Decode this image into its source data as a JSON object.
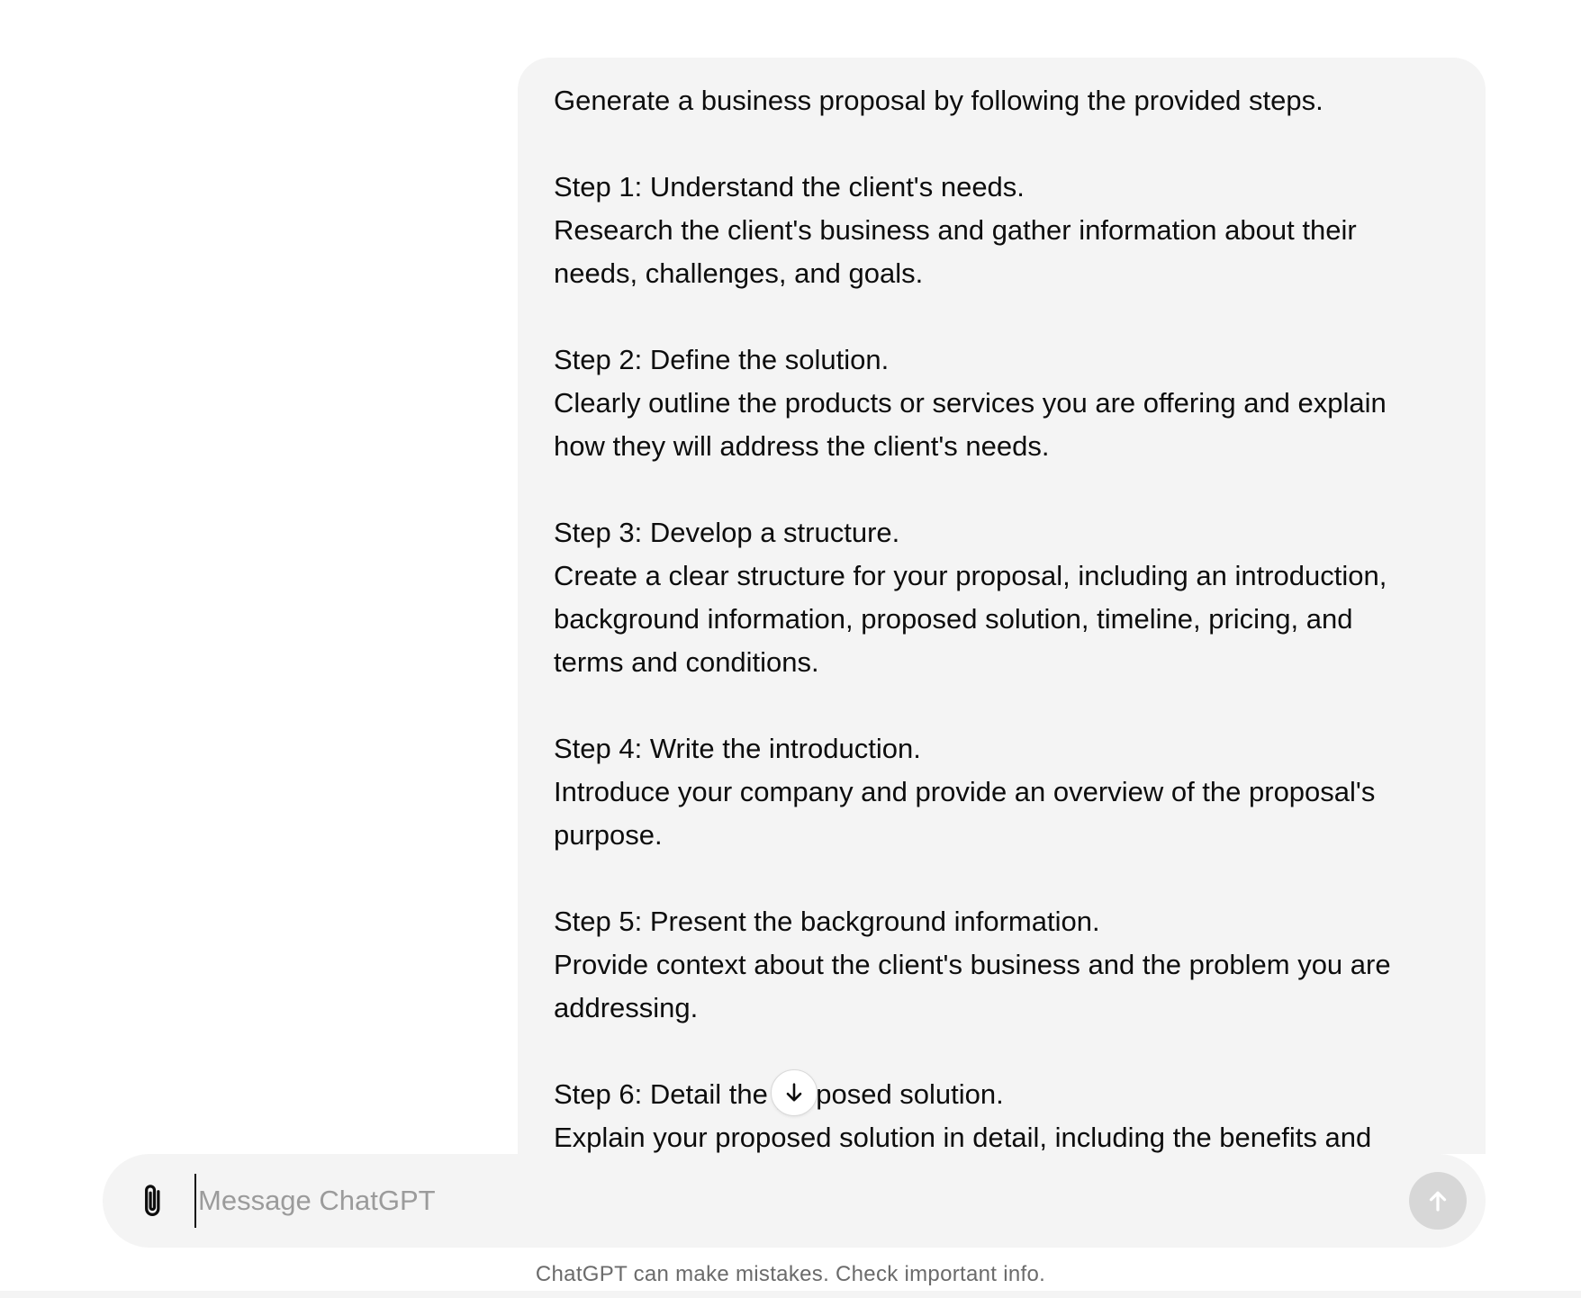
{
  "conversation": {
    "user_message_lines": [
      "Generate a business proposal by following the provided steps.",
      "",
      "Step 1: Understand the client's needs.",
      "Research the client's business and gather information about their",
      "needs, challenges, and goals.",
      "",
      "Step 2: Define the solution.",
      "Clearly outline the products or services you are offering and explain",
      "how they will address the client's needs.",
      "",
      "Step 3: Develop a structure.",
      "Create a clear structure for your proposal, including an introduction,",
      "background information, proposed solution, timeline, pricing, and",
      "terms and conditions.",
      "",
      "Step 4: Write the introduction.",
      "Introduce your company and provide an overview of the proposal's",
      "purpose.",
      "",
      "Step 5: Present the background information.",
      "Provide context about the client's business and the problem you are",
      "addressing.",
      "",
      "Step 6: Detail the proposed solution.",
      "Explain your proposed solution in detail, including the benefits and"
    ],
    "scroll_button_icon": "arrow-down-icon"
  },
  "composer": {
    "attach_icon": "paperclip-icon",
    "placeholder": "Message ChatGPT",
    "value": "",
    "send_icon": "arrow-up-icon"
  },
  "footer": {
    "disclaimer": "ChatGPT can make mistakes. Check important info."
  },
  "colors": {
    "bubble_bg": "#f4f4f4",
    "composer_bg": "#f4f4f4",
    "send_disabled": "#d7d7d7",
    "placeholder": "#9b9b9b",
    "text": "#0d0d0d"
  }
}
